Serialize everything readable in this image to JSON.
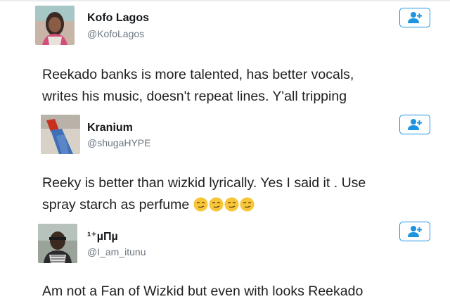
{
  "tweets": [
    {
      "name": "Kofo Lagos",
      "handle": "@KofoLagos",
      "text_lines": [
        "Reekado banks is more talented, has better vocals,",
        "writes his music, doesn't repeat lines. Y'all tripping"
      ]
    },
    {
      "name": "Kranium",
      "handle": "@shugaHYPE",
      "text_lines": [
        "Reeky is better than wizkid lyrically. Yes I said it . Use",
        "spray starch as perfume"
      ]
    },
    {
      "name": "¹⁺µΠµ",
      "handle": "@I_am_itunu",
      "text_lines": [
        "Am not a Fan of Wizkid but even with looks Reekado"
      ]
    }
  ],
  "icons": {
    "follow_button": "add-user-icon",
    "emoji": "smirking-face-emoji"
  },
  "colors": {
    "follow_border": "#1c94e0",
    "handle_gray": "#6b7680",
    "emoji_yellow": "#f7c63a"
  }
}
